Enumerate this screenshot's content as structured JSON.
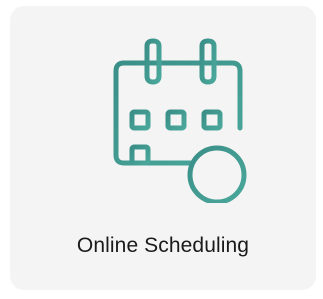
{
  "card": {
    "label": "Online Scheduling",
    "icon": "calendar-add-icon",
    "icon_gradient": [
      "#3a8f88",
      "#4aa79b"
    ],
    "background": "#f4f4f4"
  }
}
